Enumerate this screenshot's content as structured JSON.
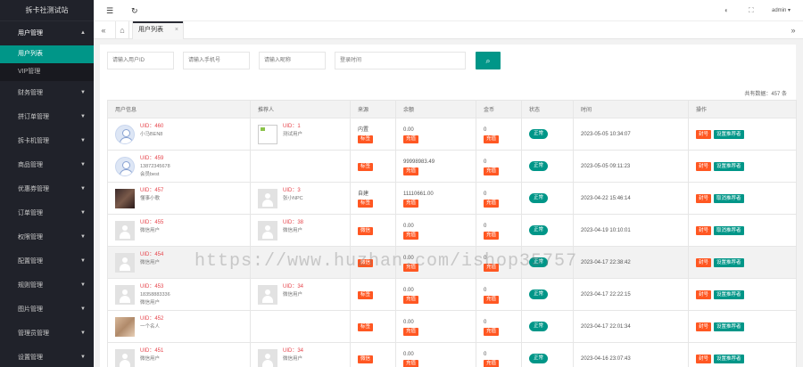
{
  "logo": "拆卡社测试站",
  "sidebar": {
    "groups": [
      {
        "label": "用户管理",
        "open": true,
        "items": [
          {
            "label": "用户列表",
            "active": true
          },
          {
            "label": "VIP管理",
            "active": false
          }
        ]
      },
      {
        "label": "财务管理"
      },
      {
        "label": "拼订单管理"
      },
      {
        "label": "拆卡机管理"
      },
      {
        "label": "商品管理"
      },
      {
        "label": "优惠券管理"
      },
      {
        "label": "订单管理"
      },
      {
        "label": "权限管理"
      },
      {
        "label": "配置管理"
      },
      {
        "label": "规则管理"
      },
      {
        "label": "图片管理"
      },
      {
        "label": "管理员管理"
      },
      {
        "label": "设置管理"
      }
    ]
  },
  "header": {
    "user": "admin ▾"
  },
  "tabs": {
    "active_label": "用户列表",
    "close": "×"
  },
  "search": {
    "uid_placeholder": "请输入用户ID",
    "phone_placeholder": "请输入手机号",
    "nickname_placeholder": "请输入昵称",
    "time_placeholder": "登录时间"
  },
  "total": "共有数据：457 条",
  "table": {
    "headers": [
      "用户信息",
      "推荐人",
      "来源",
      "余额",
      "金币",
      "状态",
      "时间",
      "操作"
    ],
    "rows": [
      {
        "avatar": "circle",
        "uid": "UID：460",
        "line2": "",
        "line3": "小马BEN8",
        "ref_avatar": "broken",
        "ref_uid": "UID：1",
        "ref_name": "测试用户",
        "source": "内置",
        "source_tag": "标签",
        "balance": "0.00",
        "balance_tag": "充值",
        "coin": "0",
        "coin_tag": "充值",
        "status": "正常",
        "time": "2023-05-05 10:34:07",
        "op1": "封号",
        "op2": "设置推荐者",
        "hl": false
      },
      {
        "avatar": "circle",
        "uid": "UID：459",
        "line2": "13872345678",
        "line3": "会员best",
        "ref_avatar": "",
        "ref_uid": "",
        "ref_name": "",
        "source": "",
        "source_tag": "标签",
        "balance": "99998983.49",
        "balance_tag": "充值",
        "coin": "0",
        "coin_tag": "充值",
        "status": "正常",
        "time": "2023-05-05 09:11:23",
        "op1": "封号",
        "op2": "设置推荐者",
        "hl": false
      },
      {
        "avatar": "photo1",
        "uid": "UID：457",
        "line2": "",
        "line3": "懂事小歌",
        "ref_avatar": "gray",
        "ref_uid": "UID：3",
        "ref_name": "张小NPC",
        "source": "自建",
        "source_tag": "标签",
        "balance": "11110661.00",
        "balance_tag": "充值",
        "coin": "0",
        "coin_tag": "充值",
        "status": "正常",
        "time": "2023-04-22 15:46:14",
        "op1": "封号",
        "op2": "取消推荐者",
        "hl": false
      },
      {
        "avatar": "gray",
        "uid": "UID：455",
        "line2": "",
        "line3": "微信用户",
        "ref_avatar": "gray",
        "ref_uid": "UID：38",
        "ref_name": "微信用户",
        "source": "",
        "source_tag": "微信",
        "balance": "0.00",
        "balance_tag": "充值",
        "coin": "0",
        "coin_tag": "充值",
        "status": "正常",
        "time": "2023-04-19 10:10:01",
        "op1": "封号",
        "op2": "取消推荐者",
        "hl": false
      },
      {
        "avatar": "gray",
        "uid": "UID：454",
        "line2": "",
        "line3": "微信用户",
        "ref_avatar": "",
        "ref_uid": "",
        "ref_name": "",
        "source": "",
        "source_tag": "微信",
        "balance": "0.00",
        "balance_tag": "充值",
        "coin": "0",
        "coin_tag": "充值",
        "status": "正常",
        "time": "2023-04-17 22:38:42",
        "op1": "封号",
        "op2": "设置推荐者",
        "hl": true
      },
      {
        "avatar": "gray",
        "uid": "UID：453",
        "line2": "18358883336",
        "line3": "微信用户",
        "ref_avatar": "gray",
        "ref_uid": "UID：34",
        "ref_name": "微信用户",
        "source": "",
        "source_tag": "标签",
        "balance": "0.00",
        "balance_tag": "充值",
        "coin": "0",
        "coin_tag": "充值",
        "status": "正常",
        "time": "2023-04-17 22:22:15",
        "op1": "封号",
        "op2": "设置推荐者",
        "hl": false
      },
      {
        "avatar": "photo2",
        "uid": "UID：452",
        "line2": "",
        "line3": "一个名人",
        "ref_avatar": "",
        "ref_uid": "",
        "ref_name": "",
        "source": "",
        "source_tag": "标签",
        "balance": "0.00",
        "balance_tag": "充值",
        "coin": "0",
        "coin_tag": "充值",
        "status": "正常",
        "time": "2023-04-17 22:01:34",
        "op1": "封号",
        "op2": "设置推荐者",
        "hl": false
      },
      {
        "avatar": "gray",
        "uid": "UID：451",
        "line2": "",
        "line3": "微信用户",
        "ref_avatar": "gray",
        "ref_uid": "UID：34",
        "ref_name": "微信用户",
        "source": "",
        "source_tag": "微信",
        "balance": "0.00",
        "balance_tag": "充值",
        "coin": "0",
        "coin_tag": "充值",
        "status": "正常",
        "time": "2023-04-16 23:07:43",
        "op1": "封号",
        "op2": "设置推荐者",
        "hl": false
      }
    ]
  },
  "watermark": "https://www.huzhan.com/ishop35757",
  "icons": {
    "menu": "☰",
    "refresh": "↻",
    "theme": "◐",
    "fullscreen": "⛶",
    "prev": "«",
    "home": "⌂",
    "next": "»",
    "search": "⌕"
  }
}
